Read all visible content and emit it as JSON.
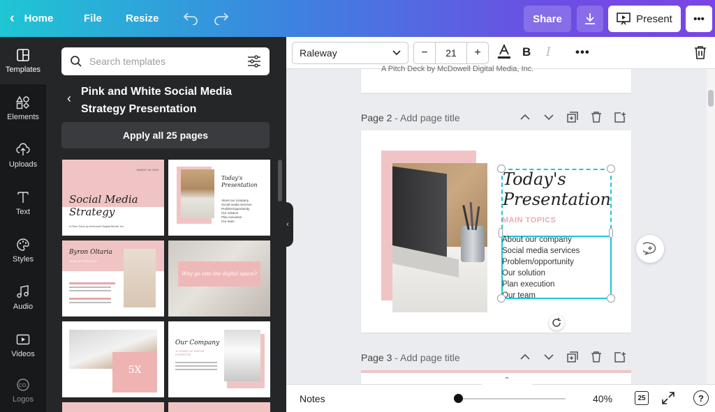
{
  "topbar": {
    "home_label": "Home",
    "file_label": "File",
    "resize_label": "Resize",
    "share_label": "Share",
    "present_label": "Present",
    "more_label": "•••"
  },
  "rail": {
    "items": [
      {
        "label": "Templates",
        "icon": "templates-icon"
      },
      {
        "label": "Elements",
        "icon": "elements-icon"
      },
      {
        "label": "Uploads",
        "icon": "uploads-icon"
      },
      {
        "label": "Text",
        "icon": "text-icon"
      },
      {
        "label": "Styles",
        "icon": "styles-icon"
      },
      {
        "label": "Audio",
        "icon": "audio-icon"
      },
      {
        "label": "Videos",
        "icon": "videos-icon"
      },
      {
        "label": "Logos",
        "icon": "logos-icon"
      }
    ]
  },
  "templates_panel": {
    "search_placeholder": "Search templates",
    "title": "Pink and White Social Media Strategy Presentation",
    "apply_label": "Apply all 25 pages",
    "thumbs": {
      "t1_date": "MARCH 16, 2023",
      "t1_title": "Social Media Strategy",
      "t1_sub": "A Pitch Deck by McDowell Digital Media, Inc.",
      "t2_title": "Today's Presentation",
      "t2_items": "About our company\nSocial media services\nProblem/opportunity\nOur solution\nPlan execution\nOur team",
      "t3_name": "Byron Oltaria",
      "t3_role": "HEAD OF STRATEGY",
      "t4_title": "Why go into the digital space?",
      "t5_num": "5X",
      "t6_title": "Our Company",
      "t6_sub": "10 YEARS OF DIGITAL EXPERTISE"
    }
  },
  "toolbar": {
    "font": "Raleway",
    "font_size": "21",
    "minus": "−",
    "plus": "+"
  },
  "canvas": {
    "page1_caption": "A Pitch Deck by McDowell Digital Media, Inc.",
    "page2_label": "Page 2",
    "page3_label": "Page 3",
    "add_title": " - Add page title",
    "slide_title": "Today's Presentation",
    "slide_subtitle": "MAIN TOPICS",
    "slide_items": [
      "About our company",
      "Social media services",
      "Problem/opportunity",
      "Our solution",
      "Plan execution",
      "Our team"
    ]
  },
  "bottombar": {
    "notes_label": "Notes",
    "zoom": "40%",
    "pages_count": "25",
    "help": "?"
  },
  "colors": {
    "accent_pink": "#f0c4c4",
    "selection": "#1ec6d4"
  }
}
